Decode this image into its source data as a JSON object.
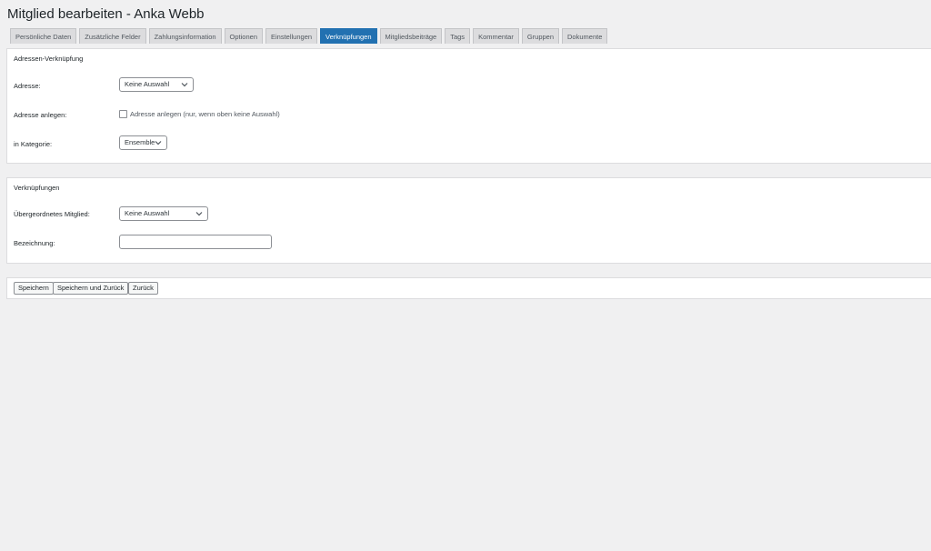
{
  "page": {
    "title": "Mitglied bearbeiten - Anka Webb"
  },
  "tabs": [
    {
      "label": "Persönliche Daten",
      "active": false
    },
    {
      "label": "Zusätzliche Felder",
      "active": false
    },
    {
      "label": "Zahlungsinformation",
      "active": false
    },
    {
      "label": "Optionen",
      "active": false
    },
    {
      "label": "Einstellungen",
      "active": false
    },
    {
      "label": "Verknüpfungen",
      "active": true
    },
    {
      "label": "Mitgliedsbeiträge",
      "active": false
    },
    {
      "label": "Tags",
      "active": false
    },
    {
      "label": "Kommentar",
      "active": false
    },
    {
      "label": "Gruppen",
      "active": false
    },
    {
      "label": "Dokumente",
      "active": false
    }
  ],
  "address_section": {
    "title": "Adressen-Verknüpfung",
    "address_label": "Adresse:",
    "address_value": "Keine Auswahl",
    "create_label": "Adresse anlegen:",
    "create_checkbox_text": "Adresse anlegen (nur, wenn oben keine Auswahl)",
    "category_label": "in Kategorie:",
    "category_value": "Ensemble"
  },
  "links_section": {
    "title": "Verknüpfungen",
    "parent_label": "Übergeordnetes Mitglied:",
    "parent_value": "Keine Auswahl",
    "designation_label": "Bezeichnung:",
    "designation_value": ""
  },
  "actions": {
    "save": "Speichern",
    "save_back": "Speichern und Zurück",
    "back": "Zurück"
  },
  "colors": {
    "accent": "#2271b1",
    "background": "#f0f0f1"
  },
  "icons": {
    "dropdown": "chevron-down-icon"
  }
}
